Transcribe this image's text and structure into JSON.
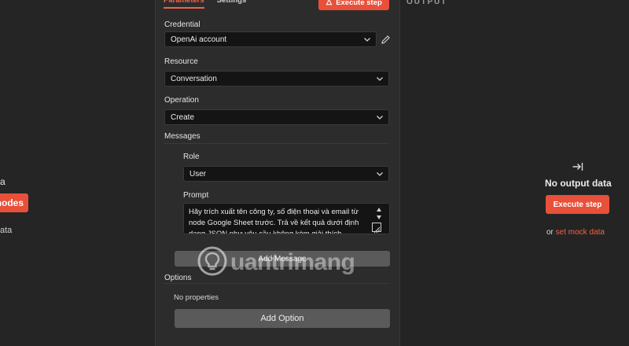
{
  "left_panel": {
    "fragment_a": "a",
    "button_label": "nodes",
    "fragment_data": "ata"
  },
  "center_panel": {
    "tabs": [
      {
        "label": "Parameters",
        "active": true
      },
      {
        "label": "Settings",
        "active": false
      }
    ],
    "execute_step_label": "Execute step",
    "credential": {
      "label": "Credential",
      "value": "OpenAi account"
    },
    "resource": {
      "label": "Resource",
      "value": "Conversation"
    },
    "operation": {
      "label": "Operation",
      "value": "Create"
    },
    "messages": {
      "label": "Messages",
      "role": {
        "label": "Role",
        "value": "User"
      },
      "prompt": {
        "label": "Prompt",
        "value": "Hãy trích xuất tên công ty, số điện thoại và email từ node Google Sheet trước. Trả về kết quả dưới định dạng JSON như yêu cầu không kèm giải thích."
      },
      "add_message_label": "Add Message"
    },
    "options": {
      "label": "Options",
      "empty_text": "No properties",
      "add_option_label": "Add Option"
    }
  },
  "right_panel": {
    "output_label": "OUTPUT",
    "no_output_text": "No output data",
    "execute_step_label": "Execute step",
    "or_text": "or ",
    "set_mock_data_label": "set mock data"
  },
  "watermark": {
    "text": "uantrimang"
  },
  "colors": {
    "accent": "#e8503a",
    "link": "#f0634a",
    "background": "#242424",
    "panel": "#2c2c2c",
    "input_bg": "#141414",
    "button_gray": "#5a5a5a"
  },
  "icons": {
    "chevron": "chevron-down-icon",
    "pencil": "pencil-icon",
    "flask": "flask-icon",
    "output": "arrow-right-to-bar-icon",
    "watermark_logo": "lightbulb-icon"
  }
}
